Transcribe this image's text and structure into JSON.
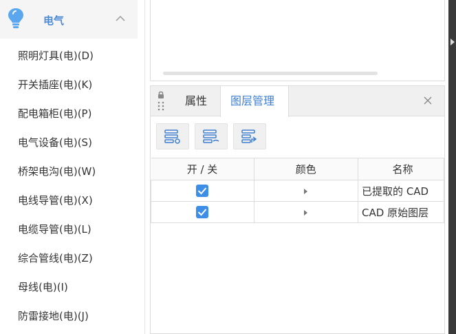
{
  "sidebar": {
    "category": {
      "label": "电气",
      "icon": "lightbulb-icon",
      "expanded": true
    },
    "items": [
      "照明灯具(电)(D)",
      "开关插座(电)(K)",
      "配电箱柜(电)(P)",
      "电气设备(电)(S)",
      "桥架电沟(电)(W)",
      "电线导管(电)(X)",
      "电缆导管(电)(L)",
      "综合管线(电)(Z)",
      "母线(电)(I)",
      "防雷接地(电)(J)"
    ]
  },
  "panel": {
    "tabs": [
      {
        "label": "属性",
        "active": false
      },
      {
        "label": "图层管理",
        "active": true
      }
    ],
    "toolbar": [
      "show-layer-icon",
      "hide-layer-icon",
      "restore-layer-icon"
    ],
    "table": {
      "headers": [
        "开 / 关",
        "颜色",
        "名称"
      ],
      "rows": [
        {
          "checked": true,
          "name": "已提取的 CAD"
        },
        {
          "checked": true,
          "name": "CAD 原始图层"
        }
      ]
    }
  },
  "colors": {
    "accent": "#3f7fd0",
    "checkbox": "#3d8ee6",
    "sidebar_header_bg": "#f5f5f5",
    "bulb": "#5aa7f0"
  }
}
